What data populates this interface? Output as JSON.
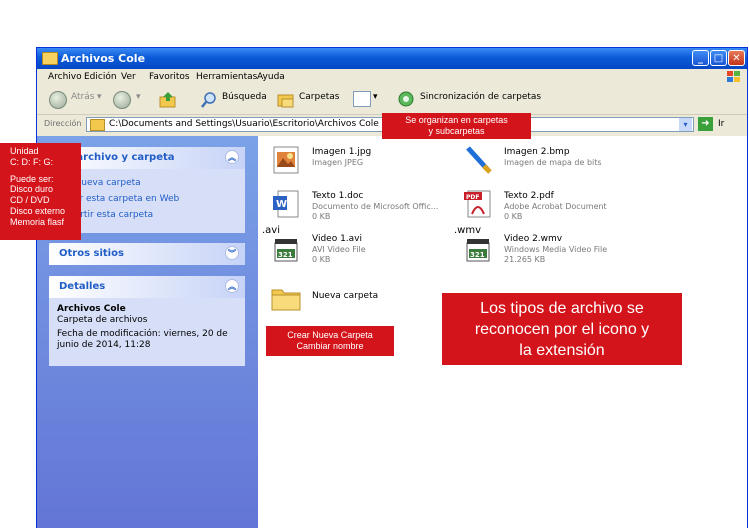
{
  "window": {
    "title": "Archivos Cole"
  },
  "menu": [
    "Archivo",
    "Edición",
    "Ver",
    "Favoritos",
    "Herramientas",
    "Ayuda"
  ],
  "toolbar": {
    "back": "Atrás",
    "search": "Búsqueda",
    "folders": "Carpetas",
    "sync": "Sincronización de carpetas"
  },
  "address": {
    "label": "Dirección",
    "path": "C:\\Documents and Settings\\Usuario\\Escritorio\\Archivos Cole",
    "go": "Ir"
  },
  "tasks": {
    "title": "de archivo y carpeta",
    "links": [
      "r nueva carpeta",
      "car esta carpeta en Web",
      "partir esta carpeta"
    ]
  },
  "other": {
    "title": "Otros sitios"
  },
  "details": {
    "title": "Detalles",
    "name": "Archivos Cole",
    "type": "Carpeta de archivos",
    "modified": "Fecha de modificación: viernes, 20 de",
    "modified2": "junio de 2014, 11:28"
  },
  "files": [
    {
      "name": "Imagen 1.jpg",
      "desc": "Imagen JPEG",
      "size": ""
    },
    {
      "name": "Imagen 2.bmp",
      "desc": "Imagen de mapa de bits",
      "size": ""
    },
    {
      "name": "Texto 1.doc",
      "desc": "Documento de Microsoft Offic...",
      "size": "0 KB"
    },
    {
      "name": "Texto 2.pdf",
      "desc": "Adobe Acrobat Document",
      "size": "0 KB"
    },
    {
      "name": "Video 1.avi",
      "desc": "AVI Video File",
      "size": "0 KB"
    },
    {
      "name": "Video 2.wmv",
      "desc": "Windows Media Video File",
      "size": "21.265 KB"
    },
    {
      "name": "Nueva carpeta",
      "desc": "",
      "size": ""
    }
  ],
  "ext_labels": {
    "avi": ".avi",
    "wmv": ".wmv",
    "pdf": "PDF",
    "num": "321"
  },
  "notes": {
    "unidad": [
      "Unidad",
      "C:  D:  F:  G:",
      "",
      "Puede ser:",
      "Disco duro",
      "CD / DVD",
      "Disco externo",
      "Memoria flasf"
    ],
    "carpetas": [
      "Se organizan en carpetas",
      "y subcarpetas"
    ],
    "nueva": [
      "Crear Nueva  Carpeta",
      "Cambiar nombre"
    ],
    "tipos": [
      "Los tipos de archivo se",
      "reconocen por el icono y",
      "la extensión"
    ]
  },
  "colors": {
    "titlebar": "#0a5bd8",
    "left_panel": "#6f8fdf",
    "note_red": "#d4141b",
    "link": "#215dc6"
  }
}
